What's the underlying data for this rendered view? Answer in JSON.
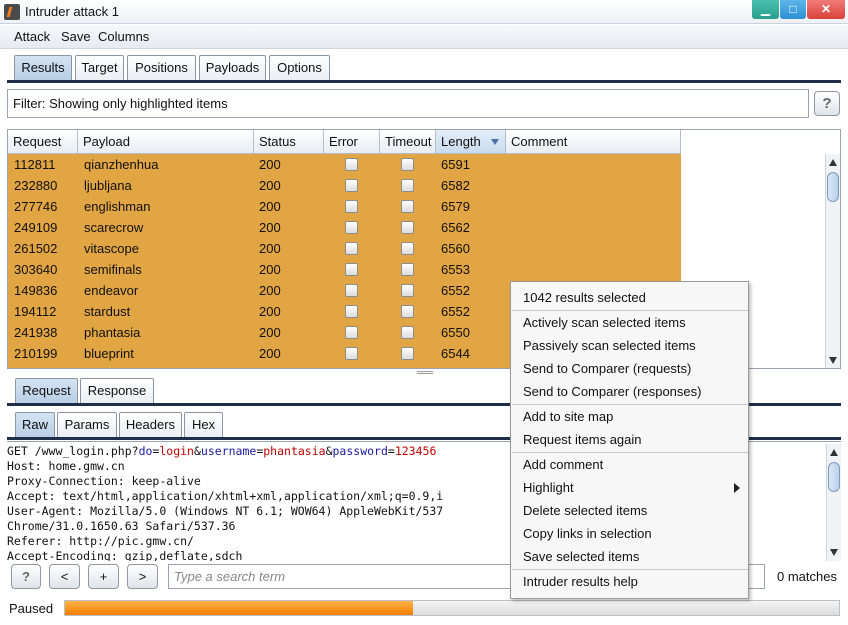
{
  "window": {
    "title": "Intruder attack 1",
    "icons": {
      "app": "burp-logo-icon",
      "min": "minimize-icon",
      "max": "maximize-icon",
      "close": "close-icon"
    },
    "close_glyph": "✕"
  },
  "menu": [
    "Attack",
    "Save",
    "Columns"
  ],
  "main_tabs": [
    "Results",
    "Target",
    "Positions",
    "Payloads",
    "Options"
  ],
  "filter": {
    "text": "Filter: Showing only highlighted items",
    "help": "?"
  },
  "table": {
    "columns": [
      "Request",
      "Payload",
      "Status",
      "Error",
      "Timeout",
      "Length",
      "Comment"
    ],
    "sort_column": "Length",
    "row_color": "#e2a543",
    "rows": [
      [
        "112811",
        "qianzhenhua",
        "200",
        "6591"
      ],
      [
        "232880",
        "ljubljana",
        "200",
        "6582"
      ],
      [
        "277746",
        "englishman",
        "200",
        "6579"
      ],
      [
        "249109",
        "scarecrow",
        "200",
        "6562"
      ],
      [
        "261502",
        "vitascope",
        "200",
        "6560"
      ],
      [
        "303640",
        "semifinals",
        "200",
        "6553"
      ],
      [
        "149836",
        "endeavor",
        "200",
        "6552"
      ],
      [
        "194112",
        "stardust",
        "200",
        "6552"
      ],
      [
        "241938",
        "phantasia",
        "200",
        "6550"
      ],
      [
        "210199",
        "blueprint",
        "200",
        "6544"
      ]
    ]
  },
  "sub_tabs": [
    "Request",
    "Response"
  ],
  "view_tabs": [
    "Raw",
    "Params",
    "Headers",
    "Hex"
  ],
  "request": {
    "line1": {
      "pre": "GET /www_login.php?",
      "k1": "do",
      "eq1": "=",
      "v1": "login",
      "amp1": "&",
      "k2": "username",
      "eq2": "=",
      "v2": "phantasia",
      "amp2": "&",
      "k3": "password",
      "eq3": "=",
      "v3": "123456"
    },
    "lines": [
      "Host: home.gmw.cn",
      "Proxy-Connection: keep-alive",
      "Accept: text/html,application/xhtml+xml,application/xml;q=0.9,i",
      "User-Agent: Mozilla/5.0 (Windows NT 6.1; WOW64) AppleWebKit/537",
      "Chrome/31.0.1650.63 Safari/537.36",
      "Referer: http://pic.gmw.cn/",
      "Accept-Encoding: gzip,deflate,sdch"
    ]
  },
  "search": {
    "help": "?",
    "prev": "<",
    "add": "+",
    "next": ">",
    "placeholder": "Type a search term",
    "matches": "0 matches"
  },
  "status": {
    "label": "Paused",
    "progress": 0.45
  },
  "context_menu": {
    "header": "1042 results selected",
    "groups": [
      [
        "Actively scan selected items",
        "Passively scan selected items",
        "Send to Comparer (requests)",
        "Send to Comparer (responses)"
      ],
      [
        "Add to site map",
        "Request items again"
      ],
      [
        "Add comment",
        "Highlight",
        "Delete selected items",
        "Copy links in selection",
        "Save selected items"
      ],
      [
        "Intruder results help"
      ]
    ]
  }
}
